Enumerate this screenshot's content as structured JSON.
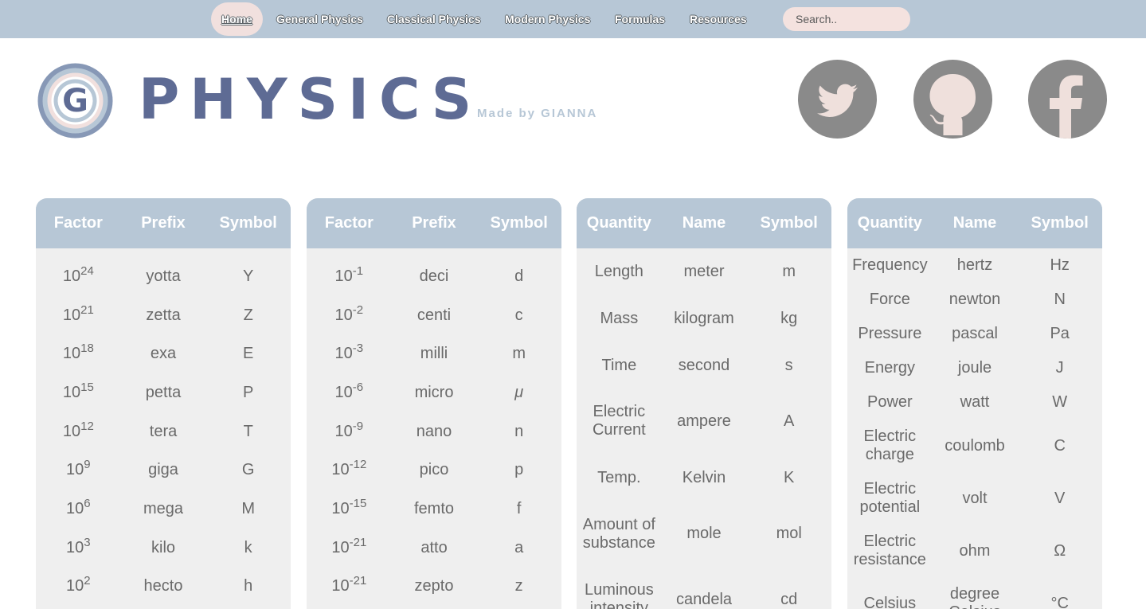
{
  "nav": {
    "items": [
      "Home",
      "General Physics",
      "Classical Physics",
      "Modern Physics",
      "Formulas",
      "Resources"
    ],
    "search_placeholder": "Search.."
  },
  "header": {
    "logo_letter": "G",
    "title": "PHYSICS",
    "made_by": "Made by GIANNA",
    "social": [
      "twitter-icon",
      "github-icon",
      "facebook-icon"
    ]
  },
  "colors": {
    "nav_bg": "#b7c7d6",
    "accent_pink": "#f1e0de",
    "brand_blue": "#5e6b94",
    "table_body": "#efefef",
    "social_gray": "#8a8a8a"
  },
  "tables": [
    {
      "headers": [
        "Factor",
        "Prefix",
        "Symbol"
      ],
      "rows": [
        {
          "base": "10",
          "exp": "24",
          "prefix": "yotta",
          "symbol": "Y"
        },
        {
          "base": "10",
          "exp": "21",
          "prefix": "zetta",
          "symbol": "Z"
        },
        {
          "base": "10",
          "exp": "18",
          "prefix": "exa",
          "symbol": "E"
        },
        {
          "base": "10",
          "exp": "15",
          "prefix": "petta",
          "symbol": "P"
        },
        {
          "base": "10",
          "exp": "12",
          "prefix": "tera",
          "symbol": "T"
        },
        {
          "base": "10",
          "exp": "9",
          "prefix": "giga",
          "symbol": "G"
        },
        {
          "base": "10",
          "exp": "6",
          "prefix": "mega",
          "symbol": "M"
        },
        {
          "base": "10",
          "exp": "3",
          "prefix": "kilo",
          "symbol": "k"
        },
        {
          "base": "10",
          "exp": "2",
          "prefix": "hecto",
          "symbol": "h"
        }
      ]
    },
    {
      "headers": [
        "Factor",
        "Prefix",
        "Symbol"
      ],
      "rows": [
        {
          "base": "10",
          "exp": "-1",
          "prefix": "deci",
          "symbol": "d"
        },
        {
          "base": "10",
          "exp": "-2",
          "prefix": "centi",
          "symbol": "c"
        },
        {
          "base": "10",
          "exp": "-3",
          "prefix": "milli",
          "symbol": "m"
        },
        {
          "base": "10",
          "exp": "-6",
          "prefix": "micro",
          "symbol": "μ"
        },
        {
          "base": "10",
          "exp": "-9",
          "prefix": "nano",
          "symbol": "n"
        },
        {
          "base": "10",
          "exp": "-12",
          "prefix": "pico",
          "symbol": "p"
        },
        {
          "base": "10",
          "exp": "-15",
          "prefix": "femto",
          "symbol": "f"
        },
        {
          "base": "10",
          "exp": "-21",
          "prefix": "atto",
          "symbol": "a"
        },
        {
          "base": "10",
          "exp": "-21",
          "prefix": "zepto",
          "symbol": "z"
        }
      ]
    },
    {
      "headers": [
        "Quantity",
        "Name",
        "Symbol"
      ],
      "rows": [
        {
          "quantity": "Length",
          "name": "meter",
          "symbol": "m"
        },
        {
          "quantity": "Mass",
          "name": "kilogram",
          "symbol": "kg"
        },
        {
          "quantity": "Time",
          "name": "second",
          "symbol": "s"
        },
        {
          "quantity": "Electric Current",
          "name": "ampere",
          "symbol": "A"
        },
        {
          "quantity": "Temp.",
          "name": "Kelvin",
          "symbol": "K"
        },
        {
          "quantity": "Amount of substance",
          "name": "mole",
          "symbol": "mol"
        },
        {
          "quantity": "Luminous intensity",
          "name": "candela",
          "symbol": "cd"
        }
      ]
    },
    {
      "headers": [
        "Quantity",
        "Name",
        "Symbol"
      ],
      "rows": [
        {
          "quantity": "Frequency",
          "name": "hertz",
          "symbol": "Hz"
        },
        {
          "quantity": "Force",
          "name": "newton",
          "symbol": "N"
        },
        {
          "quantity": "Pressure",
          "name": "pascal",
          "symbol": "Pa"
        },
        {
          "quantity": "Energy",
          "name": "joule",
          "symbol": "J"
        },
        {
          "quantity": "Power",
          "name": "watt",
          "symbol": "W"
        },
        {
          "quantity": "Electric charge",
          "name": "coulomb",
          "symbol": "C"
        },
        {
          "quantity": "Electric potential",
          "name": "volt",
          "symbol": "V"
        },
        {
          "quantity": "Electric resistance",
          "name": "ohm",
          "symbol": "Ω"
        },
        {
          "quantity": "Celsius",
          "name": "degree Celsius",
          "symbol": "°C"
        }
      ]
    }
  ]
}
